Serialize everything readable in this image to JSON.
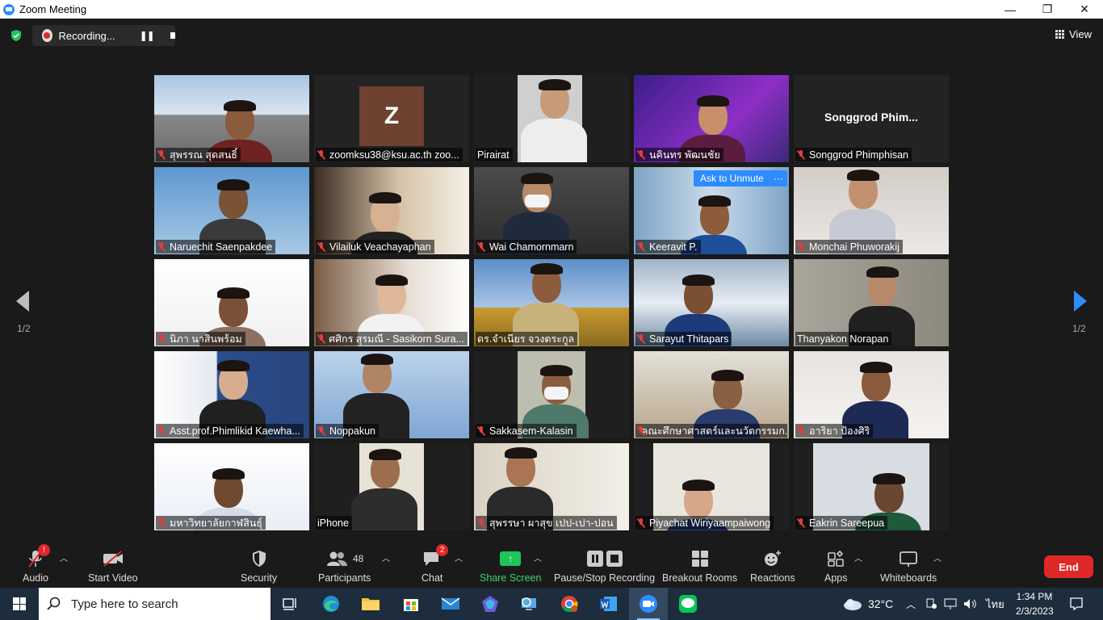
{
  "window": {
    "title": "Zoom Meeting",
    "minimize": "—",
    "restore": "❐",
    "close": "✕"
  },
  "recording": {
    "label": "Recording...",
    "pause": "❚❚"
  },
  "view": {
    "label": "View"
  },
  "pager": {
    "left": "1/2",
    "right": "1/2"
  },
  "tiles": [
    {
      "name": "สุพรรณ สุดสนธิ์",
      "muted": true
    },
    {
      "name": "zoomksu38@ksu.ac.th zoo...",
      "muted": true,
      "initial": "Z"
    },
    {
      "name": "Pirairat",
      "muted": false
    },
    {
      "name": "นคินทร พัฒนชัย",
      "muted": true
    },
    {
      "name": "Songgrod Phimphisan",
      "muted": true,
      "bigname": "Songgrod  Phim..."
    },
    {
      "name": "Naruechit Saenpakdee",
      "muted": true
    },
    {
      "name": "Vilailuk Veachayaphan",
      "muted": true
    },
    {
      "name": "Wai Chamornmarn",
      "muted": true
    },
    {
      "name": "Keeravit P.",
      "muted": true,
      "ask": "Ask to Unmute",
      "more": "···"
    },
    {
      "name": "Monchai Phuworakij",
      "muted": true
    },
    {
      "name": "นิภา นาสินพร้อม",
      "muted": true
    },
    {
      "name": "ศศิกร สุรมณี - Sasikorn Sura...",
      "muted": true
    },
    {
      "name": "ดร.จำเนียร จวงตระกูล",
      "muted": false
    },
    {
      "name": "Sarayut Thitapars",
      "muted": true
    },
    {
      "name": "Thanyakon Norapan",
      "muted": false
    },
    {
      "name": "Asst.prof.Phimlikid Kaewha...",
      "muted": true
    },
    {
      "name": "Noppakun",
      "muted": true
    },
    {
      "name": "Sakkasem-Kalasin",
      "muted": true
    },
    {
      "name": "คณะศึกษาศาสตร์และนวัตกรรมก...",
      "muted": true
    },
    {
      "name": "อาริยา ป้องศิริ",
      "muted": true
    },
    {
      "name": "มหาวิทยาลัยกาฬสินธุ์",
      "muted": true
    },
    {
      "name": "iPhone",
      "muted": false
    },
    {
      "name": "สุพรรษา ผาสุข เปป-เปา-ปอน",
      "muted": true
    },
    {
      "name": "Piyachat Wiriyaampaiwong",
      "muted": true
    },
    {
      "name": "Eakrin Sareepua",
      "muted": true
    }
  ],
  "toolbar": {
    "audio": {
      "label": "Audio",
      "badge": "!"
    },
    "video": {
      "label": "Start Video"
    },
    "security": {
      "label": "Security"
    },
    "participants": {
      "label": "Participants",
      "count": "48"
    },
    "chat": {
      "label": "Chat",
      "badge": "2"
    },
    "share": {
      "label": "Share Screen"
    },
    "recording": {
      "label": "Pause/Stop Recording"
    },
    "breakout": {
      "label": "Breakout Rooms"
    },
    "reactions": {
      "label": "Reactions"
    },
    "apps": {
      "label": "Apps"
    },
    "whiteboards": {
      "label": "Whiteboards"
    },
    "end": {
      "label": "End"
    }
  },
  "taskbar": {
    "search_placeholder": "Type here to search",
    "weather": "32°C",
    "language": "ไทย",
    "time": "1:34 PM",
    "date": "2/3/2023"
  },
  "colors": {
    "accent": "#2d8cff",
    "end": "#e02828",
    "share": "#1fc45a",
    "speaking": "#c6e83c"
  }
}
